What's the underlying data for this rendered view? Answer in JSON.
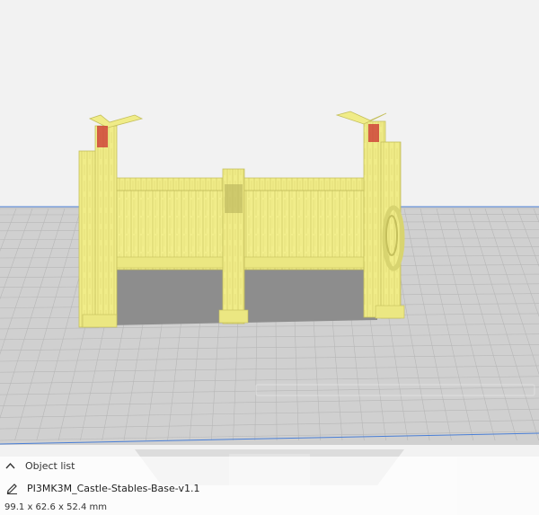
{
  "colors": {
    "background": "#f2f2f2",
    "build_plate": "#d0d0d0",
    "grid_lines": "#b3b3b3",
    "plate_edge_blue": "#4a7fd6",
    "model_yellow": "#f0ec88",
    "model_shadow": "#d8d470",
    "model_support_red": "#cc3030",
    "cast_shadow": "#8d8d8d",
    "panel_bg": "#ffffff"
  },
  "icons": {
    "collapse": "chevron-up-icon",
    "edit": "pencil-icon"
  },
  "object_list": {
    "title": "Object list",
    "items": [
      {
        "name": "PI3MK3M_Castle-Stables-Base-v1.1"
      }
    ],
    "dimensions": "99.1 x 62.6 x 52.4 mm"
  }
}
